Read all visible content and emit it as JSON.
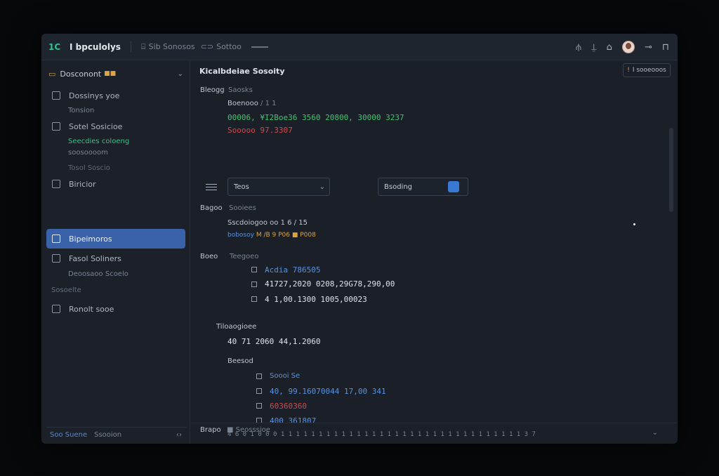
{
  "titlebar": {
    "logo": "1C",
    "app_name": "I bpculolys",
    "crumb_1": "Sib Sonosos",
    "crumb_2": "Sottoo"
  },
  "sidebar": {
    "workspace": "Dosconont",
    "workspace_badge": "■■",
    "items": [
      {
        "label": "Dossinys yoe",
        "sub": "Tonsion"
      },
      {
        "label": "Sotel Sosicioe",
        "sub_green": "Seecdies coloeng",
        "sub": "soosoooom"
      },
      {
        "label": "Biricior",
        "group": "Tosol Soscio"
      },
      {
        "label": "Bipeimoros"
      },
      {
        "label": "Fasol Soliners",
        "sub": "Deoosaoo Scoelo"
      },
      {
        "label": "Ronolt sooe",
        "group": "Sosoelte"
      }
    ],
    "footer": {
      "link": "Soo Suene",
      "item": "Ssooion"
    }
  },
  "main": {
    "title": "Kicalbdeiae Sosoity",
    "top_button": "I sooeooos",
    "section1": {
      "label": "Bleogg",
      "sub": "Saosks",
      "heading": "Boenooo",
      "heading_suffix": "/ 1 1",
      "value_green": "00006, ¥I2Boe36 3560 20800, 30000 3237",
      "value_red": "Sooooo 97.3307"
    },
    "filter": {
      "select_value": "Teos",
      "search_value": "Bsoding"
    },
    "section2": {
      "label": "Bagoo",
      "sub": "Sooiees",
      "line1": "Sscdoiogoo oo 1 6  / 15",
      "line2_prefix": "bobosoy",
      "line2_value": "M /B 9 P06 ■ P008"
    },
    "section3": {
      "label": "Boeo",
      "sub": "Teegoeo",
      "rows": [
        "Acdia 786505",
        "41727,2020 0208,29G78,290,00",
        "4 1,00.1300 1005,00023"
      ]
    },
    "section4": {
      "label": "Tiloaogioee",
      "value": "40 71 2060 44,1.2060"
    },
    "section5": {
      "label": "Beesod",
      "rows": [
        {
          "text": "Soooi Se",
          "color": "blue"
        },
        {
          "text": "40, 99.16070044 17,00 341",
          "color": "blue"
        },
        {
          "text": "60360360",
          "color": "red"
        },
        {
          "text": "400 361807",
          "color": "blue"
        }
      ],
      "trailing": "4 6 0 1 0 0 0   1 1 1 1 1 1 1 1 1 1 1 1 1 1 1 1 1 1 1 1 1 1 1 1 1 1 1 1 1 1 1 1 3 7"
    },
    "bottom": {
      "label": "Brapo",
      "value": "■ Seosssioe"
    }
  },
  "colors": {
    "accent": "#3a62a8",
    "green": "#47c272",
    "red": "#d24a4a",
    "blue": "#5a92de",
    "orange": "#e0a33a"
  }
}
